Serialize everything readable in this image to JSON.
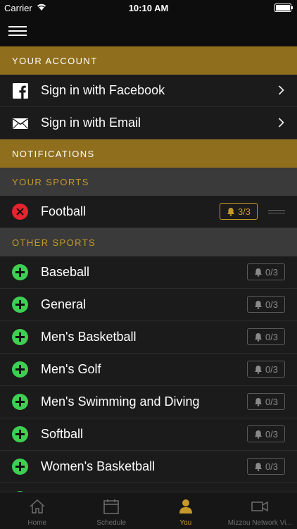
{
  "status": {
    "carrier": "Carrier",
    "time": "10:10 AM"
  },
  "account": {
    "header": "YOUR ACCOUNT",
    "items": [
      {
        "label": "Sign in with Facebook",
        "icon": "facebook-icon"
      },
      {
        "label": "Sign in with Email",
        "icon": "mail-icon"
      }
    ]
  },
  "notifications": {
    "header": "NOTIFICATIONS",
    "your_sports_header": "YOUR SPORTS",
    "your_sports": [
      {
        "label": "Football",
        "badge": "3/3"
      }
    ],
    "other_sports_header": "OTHER SPORTS",
    "other_sports": [
      {
        "label": "Baseball",
        "badge": "0/3"
      },
      {
        "label": "General",
        "badge": "0/3"
      },
      {
        "label": "Men's Basketball",
        "badge": "0/3"
      },
      {
        "label": "Men's Golf",
        "badge": "0/3"
      },
      {
        "label": "Men's Swimming and Diving",
        "badge": "0/3"
      },
      {
        "label": "Softball",
        "badge": "0/3"
      },
      {
        "label": "Women's Basketball",
        "badge": "0/3"
      }
    ]
  },
  "tabs": [
    {
      "label": "Home",
      "icon": "home-icon"
    },
    {
      "label": "Schedule",
      "icon": "calendar-icon"
    },
    {
      "label": "You",
      "icon": "person-icon"
    },
    {
      "label": "Mizzou Network Vi...",
      "icon": "video-camera-icon"
    }
  ],
  "colors": {
    "gold": "#c69a2a",
    "header_gold": "#8f6e1d",
    "add_green": "#3ecf52",
    "remove_red": "#e52430"
  }
}
